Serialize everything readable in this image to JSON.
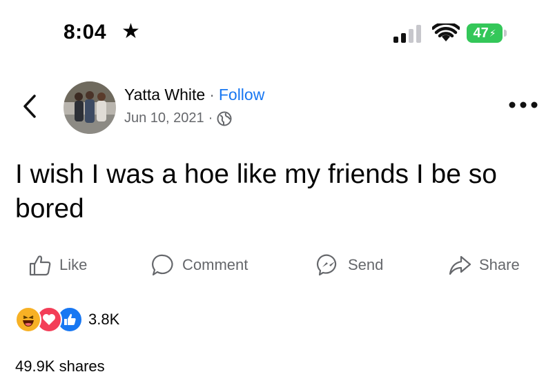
{
  "status_bar": {
    "time": "8:04",
    "star_glyph": "★",
    "battery": "47",
    "icons": [
      "signal-icon",
      "wifi-icon",
      "battery-icon"
    ]
  },
  "header": {
    "author": "Yatta White",
    "separator": "·",
    "follow_label": "Follow",
    "date": "Jun 10, 2021",
    "date_separator": "·",
    "icons": [
      "back-chevron-icon",
      "globe-icon",
      "more-options-icon"
    ]
  },
  "post": {
    "text": "I wish I was a hoe like my friends I be so bored"
  },
  "actions": [
    {
      "label": "Like",
      "icon": "thumbs-up-icon"
    },
    {
      "label": "Comment",
      "icon": "comment-bubble-icon"
    },
    {
      "label": "Send",
      "icon": "messenger-icon"
    },
    {
      "label": "Share",
      "icon": "share-arrow-icon"
    }
  ],
  "reactions": {
    "types": [
      "haha",
      "love",
      "like"
    ],
    "count": "3.8K"
  },
  "shares": "49.9K shares",
  "colors": {
    "accent": "#1877f2",
    "secondary_text": "#65676b",
    "battery": "#34c759",
    "love": "#f33e58",
    "haha": "#f7b125"
  }
}
